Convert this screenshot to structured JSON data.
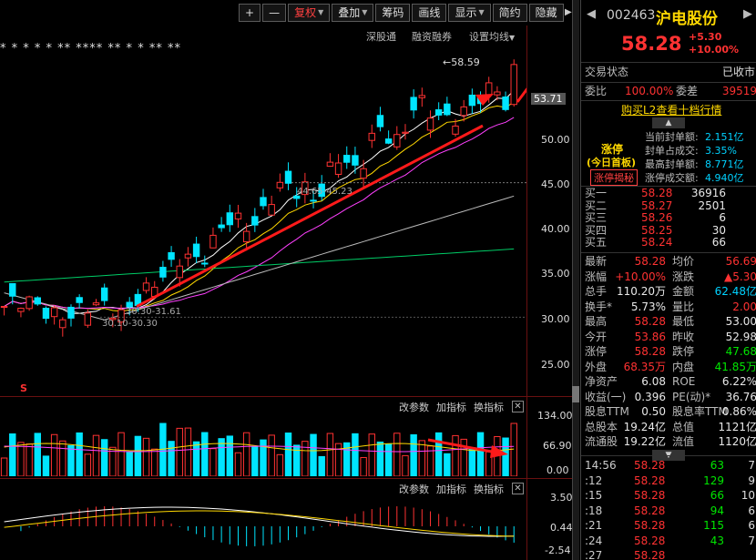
{
  "toolbar": {
    "plus": "+",
    "minus": "—",
    "buttons": [
      {
        "label": "复权",
        "dropdown": true,
        "active": true
      },
      {
        "label": "叠加",
        "dropdown": true,
        "active": false
      },
      {
        "label": "筹码",
        "dropdown": false,
        "active": false
      },
      {
        "label": "画线",
        "dropdown": false,
        "active": false
      },
      {
        "label": "显示",
        "dropdown": true,
        "active": false
      },
      {
        "label": "简约",
        "dropdown": false,
        "active": false
      },
      {
        "label": "隐藏",
        "dropdown": false,
        "active": false
      }
    ],
    "collapse_arrow": "▶"
  },
  "chart_header": {
    "stars": "*  *  *  *              *        **  ****      **      *    *      **  **",
    "links": [
      "深股通",
      "融资融券",
      "设置均线"
    ]
  },
  "price_axis": {
    "current_tag": "53.71",
    "ticks": [
      "50.00",
      "45.00",
      "40.00",
      "35.00",
      "30.00",
      "25.00"
    ]
  },
  "annotations": {
    "high": "58.59",
    "range1": "44.65-45.23",
    "range2": "30.30-31.61",
    "low": "30.10-30.30",
    "marker": "S"
  },
  "volume_panel": {
    "buttons": [
      "改参数",
      "加指标",
      "换指标"
    ],
    "close": "✕",
    "ticks": [
      "134.00",
      "66.90",
      "0.00"
    ]
  },
  "macd_panel": {
    "buttons": [
      "改参数",
      "加指标",
      "换指标"
    ],
    "close": "✕",
    "ticks": [
      "3.50",
      "0.44",
      "-2.54"
    ]
  },
  "stock": {
    "code": "002463",
    "name": "沪电股份",
    "price": "58.28",
    "change": "+5.30",
    "change_pct": "+10.00%",
    "status_label": "交易状态",
    "status_value": "已收市",
    "weibi_label": "委比",
    "weibi_value": "100.00%",
    "weicha_label": "委差",
    "weicha_value": "39519",
    "level2_link": "购买L2查看十档行情"
  },
  "limit_info": {
    "tag": "涨停",
    "sub": "(今日首板)",
    "reveal_button": "涨停揭秘",
    "rows": [
      {
        "label": "当前封单额:",
        "value": "2.151亿"
      },
      {
        "label": "封单占成交:",
        "value": "3.35%"
      },
      {
        "label": "最高封单额:",
        "value": "8.771亿"
      },
      {
        "label": "涨停成交额:",
        "value": "4.940亿"
      }
    ]
  },
  "order_book": [
    {
      "label": "卖五",
      "price": "",
      "vol": ""
    },
    {
      "label": "卖四",
      "price": "",
      "vol": ""
    },
    {
      "label": "卖三",
      "price": "",
      "vol": ""
    },
    {
      "label": "卖二",
      "price": "",
      "vol": ""
    },
    {
      "label": "卖一",
      "price": "",
      "vol": ""
    },
    {
      "label": "买一",
      "price": "58.28",
      "vol": "36916"
    },
    {
      "label": "买二",
      "price": "58.27",
      "vol": "2501"
    },
    {
      "label": "买三",
      "price": "58.26",
      "vol": "6"
    },
    {
      "label": "买四",
      "price": "58.25",
      "vol": "30"
    },
    {
      "label": "买五",
      "price": "58.24",
      "vol": "66"
    }
  ],
  "quotes": [
    {
      "l1": "最新",
      "v1": "58.28",
      "c1": "red",
      "l2": "均价",
      "v2": "56.69",
      "c2": "red"
    },
    {
      "l1": "涨幅",
      "v1": "+10.00%",
      "c1": "red",
      "l2": "涨跌",
      "v2": "▲5.30",
      "c2": "red"
    },
    {
      "l1": "总手",
      "v1": "110.20万",
      "c1": "wht",
      "l2": "金额",
      "v2": "62.48亿",
      "c2": "cyn"
    },
    {
      "l1": "换手*",
      "v1": "5.73%",
      "c1": "wht",
      "l2": "量比",
      "v2": "2.00",
      "c2": "red"
    },
    {
      "l1": "最高",
      "v1": "58.28",
      "c1": "red",
      "l2": "最低",
      "v2": "53.00",
      "c2": "wht"
    },
    {
      "l1": "今开",
      "v1": "53.86",
      "c1": "red",
      "l2": "昨收",
      "v2": "52.98",
      "c2": "wht"
    },
    {
      "l1": "涨停",
      "v1": "58.28",
      "c1": "red",
      "l2": "跌停",
      "v2": "47.68",
      "c2": "grn"
    },
    {
      "l1": "外盘",
      "v1": "68.35万",
      "c1": "red",
      "l2": "内盘",
      "v2": "41.85万",
      "c2": "grn"
    },
    {
      "l1": "净资产",
      "v1": "6.08",
      "c1": "wht",
      "l2": "ROE",
      "v2": "6.22%",
      "c2": "wht"
    },
    {
      "l1": "收益(一)",
      "v1": "0.396",
      "c1": "wht",
      "l2": "PE(动)*",
      "v2": "36.76",
      "c2": "wht"
    },
    {
      "l1": "股息TTM",
      "v1": "0.50",
      "c1": "wht",
      "l2": "股息率TTM",
      "v2": "0.86%",
      "c2": "wht"
    },
    {
      "l1": "总股本",
      "v1": "19.24亿",
      "c1": "wht",
      "l2": "总值",
      "v2": "1121亿",
      "c2": "wht"
    },
    {
      "l1": "流通股",
      "v1": "19.22亿",
      "c1": "wht",
      "l2": "流值",
      "v2": "1120亿",
      "c2": "wht"
    }
  ],
  "ticks": [
    {
      "time": "14:56",
      "price": "58.28",
      "vol": "63",
      "n": "7"
    },
    {
      "time": ":12",
      "price": "58.28",
      "vol": "129",
      "n": "9"
    },
    {
      "time": ":15",
      "price": "58.28",
      "vol": "66",
      "n": "10"
    },
    {
      "time": ":18",
      "price": "58.28",
      "vol": "94",
      "n": "6"
    },
    {
      "time": ":21",
      "price": "58.28",
      "vol": "115",
      "n": "6"
    },
    {
      "time": ":24",
      "price": "58.28",
      "vol": "43",
      "n": "7"
    },
    {
      "time": ":27",
      "price": "58.28",
      "vol": "",
      "n": ""
    }
  ],
  "colors": {
    "up": "#ff3232",
    "down": "#00e5ff",
    "ma5": "#ffffff",
    "ma10": "#ffd800",
    "ma20": "#ff40ff",
    "ma60": "#00cc66",
    "ma120": "#bbbbbb",
    "arrow": "#ff1a1a"
  }
}
